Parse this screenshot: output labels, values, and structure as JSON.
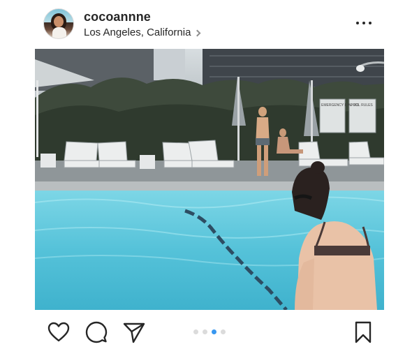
{
  "post": {
    "username": "cocoannne",
    "location": "Los Angeles, California",
    "carousel": {
      "count": 4,
      "active_index": 2
    }
  },
  "photo": {
    "signs": [
      "EMERGENCY DIAL 911",
      "POOL RULES"
    ]
  },
  "icons": {
    "avatar": "profile-avatar",
    "more": "ellipsis-icon",
    "like": "heart-icon",
    "comment": "comment-bubble-icon",
    "share": "paper-plane-icon",
    "save": "bookmark-icon"
  },
  "colors": {
    "text": "#262626",
    "muted": "#8e8e8e",
    "active_dot": "#3897f0",
    "inactive_dot": "#dbdbdb",
    "pool_water": "#55c2d9"
  }
}
